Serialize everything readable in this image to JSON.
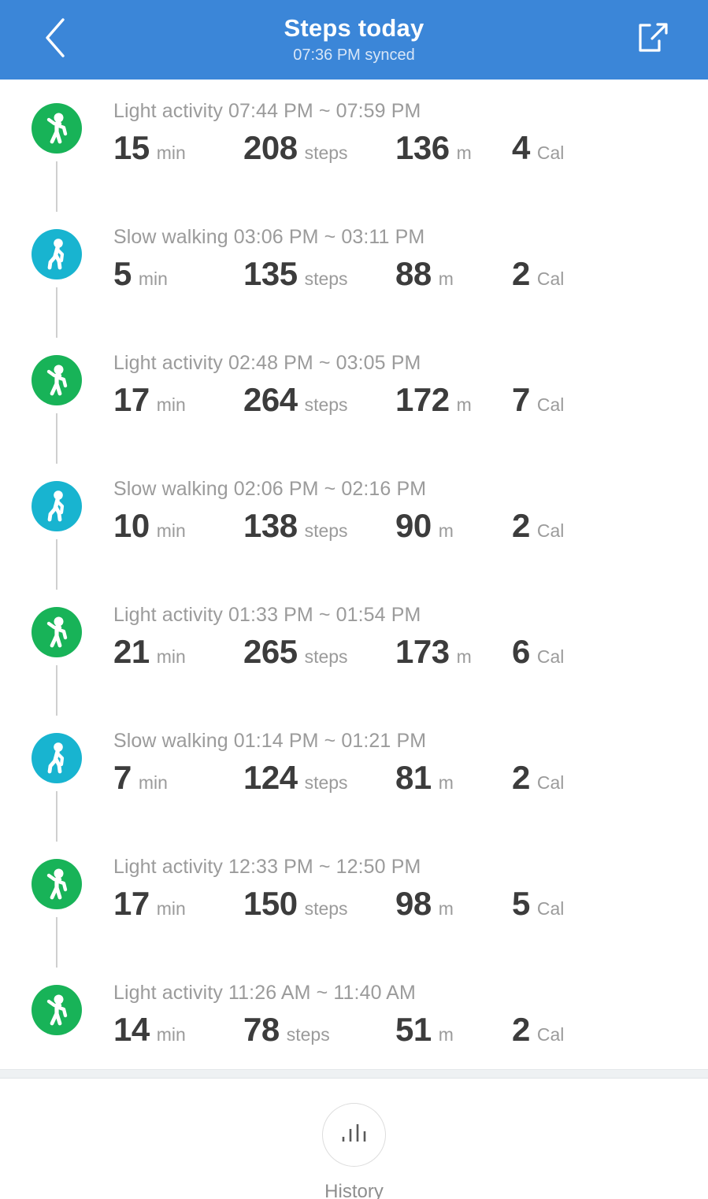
{
  "header": {
    "title": "Steps today",
    "subtitle": "07:36 PM synced",
    "back_icon": "chevron-left-icon",
    "share_icon": "share-external-icon",
    "bg_color": "#3b86d8"
  },
  "colors": {
    "light_activity": "#18b358",
    "slow_walking": "#18b4d0",
    "value_text": "#3c3c3c",
    "unit_text": "#9b9b9b",
    "connector": "#cfcfcf"
  },
  "units": {
    "duration": "min",
    "steps": "steps",
    "distance": "m",
    "calories": "Cal"
  },
  "activities": [
    {
      "type": "Light activity",
      "icon": "light-activity-icon",
      "color": "#18b358",
      "start": "07:44 PM",
      "end": "07:59 PM",
      "time_range": "Light activity 07:44 PM ~ 07:59 PM",
      "duration": "15",
      "steps": "208",
      "distance": "136",
      "calories": "4"
    },
    {
      "type": "Slow walking",
      "icon": "slow-walking-icon",
      "color": "#18b4d0",
      "start": "03:06 PM",
      "end": "03:11 PM",
      "time_range": "Slow walking 03:06 PM ~ 03:11 PM",
      "duration": "5",
      "steps": "135",
      "distance": "88",
      "calories": "2"
    },
    {
      "type": "Light activity",
      "icon": "light-activity-icon",
      "color": "#18b358",
      "start": "02:48 PM",
      "end": "03:05 PM",
      "time_range": "Light activity 02:48 PM ~ 03:05 PM",
      "duration": "17",
      "steps": "264",
      "distance": "172",
      "calories": "7"
    },
    {
      "type": "Slow walking",
      "icon": "slow-walking-icon",
      "color": "#18b4d0",
      "start": "02:06 PM",
      "end": "02:16 PM",
      "time_range": "Slow walking 02:06 PM ~ 02:16 PM",
      "duration": "10",
      "steps": "138",
      "distance": "90",
      "calories": "2"
    },
    {
      "type": "Light activity",
      "icon": "light-activity-icon",
      "color": "#18b358",
      "start": "01:33 PM",
      "end": "01:54 PM",
      "time_range": "Light activity 01:33 PM ~ 01:54 PM",
      "duration": "21",
      "steps": "265",
      "distance": "173",
      "calories": "6"
    },
    {
      "type": "Slow walking",
      "icon": "slow-walking-icon",
      "color": "#18b4d0",
      "start": "01:14 PM",
      "end": "01:21 PM",
      "time_range": "Slow walking 01:14 PM ~ 01:21 PM",
      "duration": "7",
      "steps": "124",
      "distance": "81",
      "calories": "2"
    },
    {
      "type": "Light activity",
      "icon": "light-activity-icon",
      "color": "#18b358",
      "start": "12:33 PM",
      "end": "12:50 PM",
      "time_range": "Light activity 12:33 PM ~ 12:50 PM",
      "duration": "17",
      "steps": "150",
      "distance": "98",
      "calories": "5"
    },
    {
      "type": "Light activity",
      "icon": "light-activity-icon",
      "color": "#18b358",
      "start": "11:26 AM",
      "end": "11:40 AM",
      "time_range": "Light activity 11:26 AM ~ 11:40 AM",
      "duration": "14",
      "steps": "78",
      "distance": "51",
      "calories": "2"
    }
  ],
  "footer": {
    "history_label": "History",
    "history_icon": "bar-chart-icon"
  }
}
